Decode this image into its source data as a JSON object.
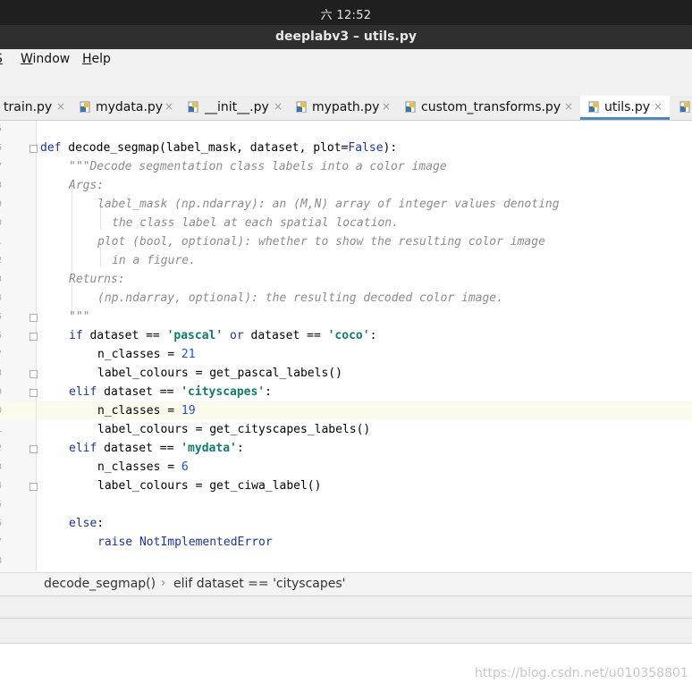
{
  "system": {
    "clock": "六 12:52"
  },
  "window": {
    "title": "deeplabv3 – utils.py"
  },
  "menu": [
    {
      "pre": "",
      "mn": "S",
      "post": ""
    },
    {
      "pre": "",
      "mn": "W",
      "post": "indow"
    },
    {
      "pre": "",
      "mn": "H",
      "post": "elp"
    }
  ],
  "tabs": [
    {
      "label": "train.py",
      "active": false
    },
    {
      "label": "mydata.py",
      "active": false
    },
    {
      "label": "__init__.py",
      "active": false
    },
    {
      "label": "mypath.py",
      "active": false
    },
    {
      "label": "custom_transforms.py",
      "active": false
    },
    {
      "label": "utils.py",
      "active": true
    }
  ],
  "tab_close_glyph": "×",
  "code": {
    "def_kw": "def",
    "def_rest": " decode_segmap(label_mask, dataset, plot=",
    "false_kw": "False",
    "def_end": "):",
    "doc1": "\"\"\"Decode segmentation class labels into a color image",
    "doc2": "Args:",
    "doc3": "label_mask (np.ndarray): an (M,N) array of integer values denoting",
    "doc4": "the class label at each spatial location.",
    "doc5": "plot (bool, optional): whether to show the resulting color image",
    "doc6": "in a figure.",
    "doc7": "Returns:",
    "doc8": "(np.ndarray, optional): the resulting decoded color image.",
    "doc9": "\"\"\"",
    "if_kw": "if",
    "if_a": " dataset == ",
    "if_s1": "'pascal'",
    "or_kw": " or",
    "if_b": " dataset == ",
    "if_s2": "'coco'",
    "if_c": ":",
    "nc": "n_classes = ",
    "nc1": "21",
    "lc1": "label_colours = get_pascal_labels()",
    "elif_kw": "elif",
    "elif_a": " dataset == ",
    "elif_s1": "'cityscapes'",
    "elif_c": ":",
    "nc2": "19",
    "lc2": "label_colours = get_cityscapes_labels()",
    "elif_s2": "'mydata'",
    "nc3": "6",
    "lc3": "label_colours = get_ciwa_label()",
    "else_kw": "else",
    "else_c": ":",
    "raise_kw": "raise",
    "raise_err": " NotImplementedError"
  },
  "breadcrumbs": {
    "first": "decode_segmap()",
    "sep": "›",
    "second": "elif dataset == 'cityscapes'"
  },
  "watermark": "https://blog.csdn.net/u010358801",
  "colors": {
    "keyword": "#1b33a6",
    "string": "#0c7f6c",
    "number": "#1750eb",
    "docstring": "#8c8c8c",
    "active_tab_underline": "#4a88c7",
    "caret_line": "#fcfaed"
  }
}
